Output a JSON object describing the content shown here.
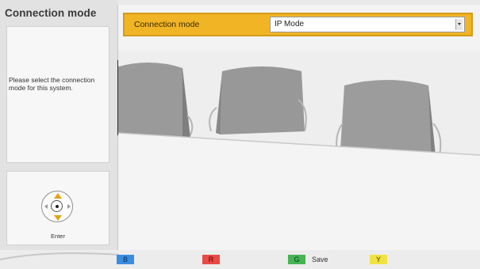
{
  "sidebar": {
    "title": "Connection mode",
    "help_text": "Please select the connection mode for this system.",
    "nav_enter_label": "Enter"
  },
  "form": {
    "connection_mode_label": "Connection mode",
    "connection_mode_value": "IP Mode"
  },
  "bottom_bar": {
    "keys": [
      {
        "key": "B",
        "color": "#3b8de0"
      },
      {
        "key": "R",
        "color": "#e84b45"
      },
      {
        "key": "G",
        "color": "#45b356",
        "label": "Save"
      },
      {
        "key": "Y",
        "color": "#f2e241"
      }
    ]
  },
  "colors": {
    "highlight": "#f1b424"
  },
  "icons": {
    "navigation": "dpad-navigation-icon",
    "select": "dropdown-arrow-icon"
  }
}
